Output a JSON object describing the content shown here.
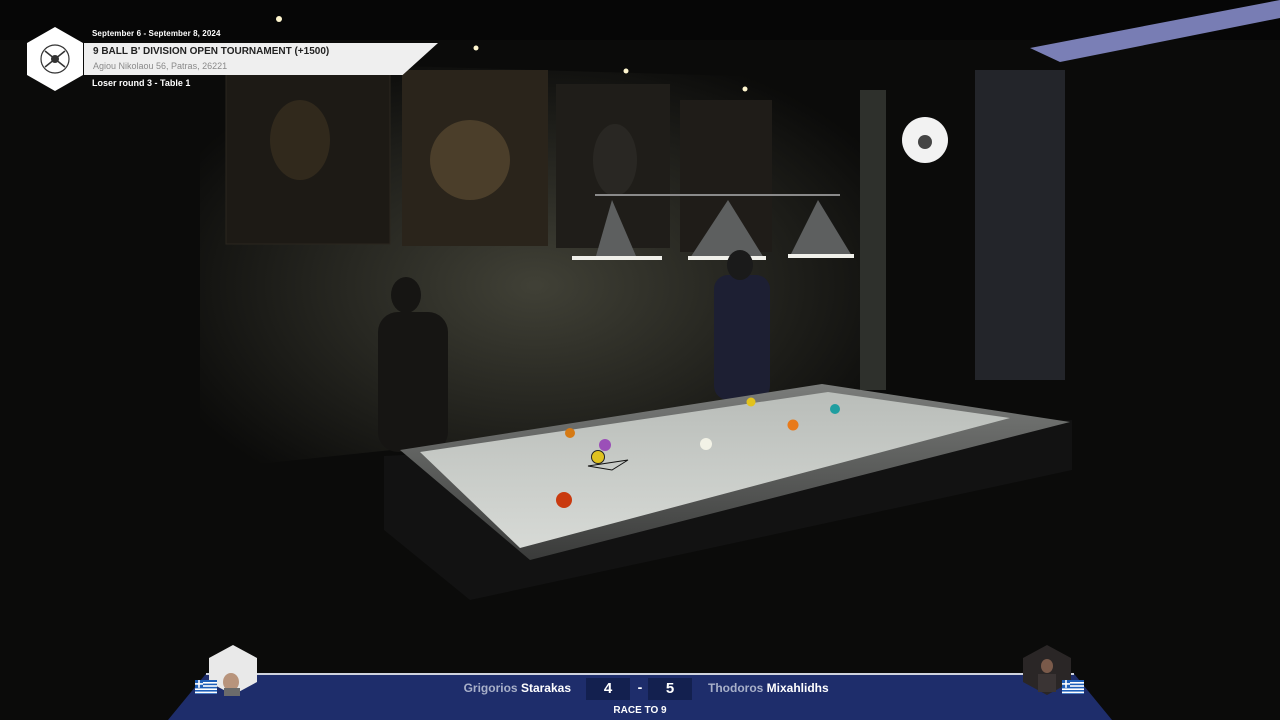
{
  "header": {
    "date_range": "September 6 - September 8, 2024",
    "tournament_title": "9 BALL B' DIVISION OPEN TOURNAMENT (+1500)",
    "address": "Agiou Nikolaou 56, Patras, 26221",
    "round": "Loser round 3 - Table 1"
  },
  "scoreboard": {
    "player_left": {
      "first_name": "Grigorios",
      "last_name": "Starakas",
      "score": "4",
      "flag": "greece-flag-icon"
    },
    "player_right": {
      "first_name": "Thodoros",
      "last_name": "Mixahlidhs",
      "score": "5",
      "flag": "greece-flag-icon"
    },
    "separator": "-",
    "race": "RACE TO 9"
  },
  "colors": {
    "scoreboard_bar": "#1e2d6b",
    "score_box": "#13204f",
    "felt": "#cfd3cf"
  }
}
